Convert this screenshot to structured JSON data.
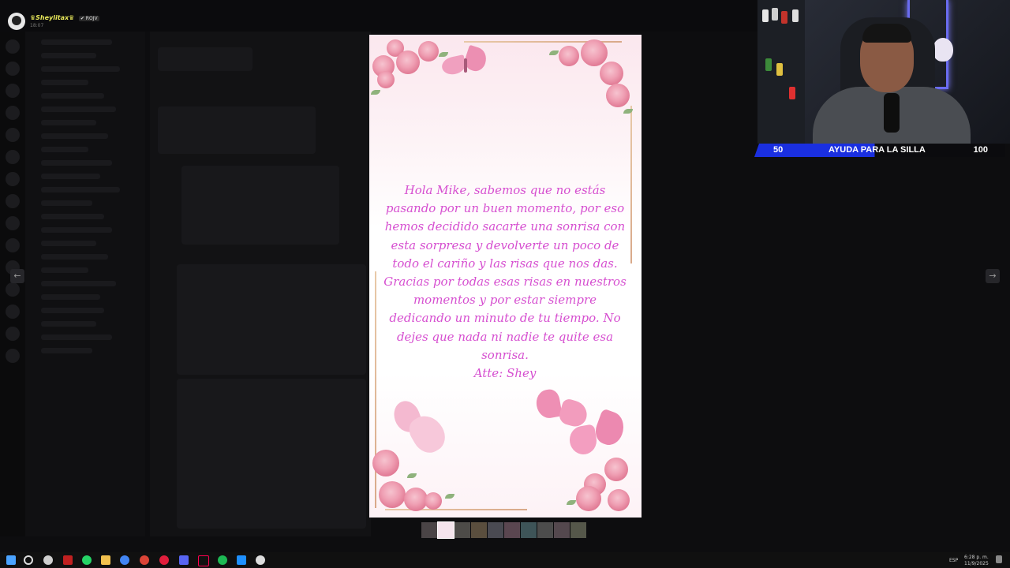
{
  "profile": {
    "name": "♛Sheylitax♛",
    "badge": "✔ ROJV",
    "status": "18:07"
  },
  "letter": {
    "body": "Hola Mike, sabemos que no estás pasando por un buen momento, por eso hemos decidido sacarte una sonrisa con esta sorpresa y devolverte un poco de todo el cariño y las risas que nos das. Gracias por todas esas risas en nuestros momentos y por estar siempre dedicando un minuto de tu tiempo. No dejes que nada ni nadie te quite esa sonrisa.",
    "signature": "Atte: Shey"
  },
  "goal": {
    "current": "50",
    "label": "AYUDA PARA LA SILLA",
    "target": "100",
    "progress": 0.5,
    "accent": "#1a2fe0"
  },
  "viewer": {
    "thumbnail_count": 10,
    "active_index": 1,
    "prev_icon": "arrow-left-icon",
    "next_icon": "arrow-right-icon"
  },
  "tray": {
    "lang": "ESP",
    "time": "6:28 p. m.",
    "date": "11/9/2025"
  }
}
